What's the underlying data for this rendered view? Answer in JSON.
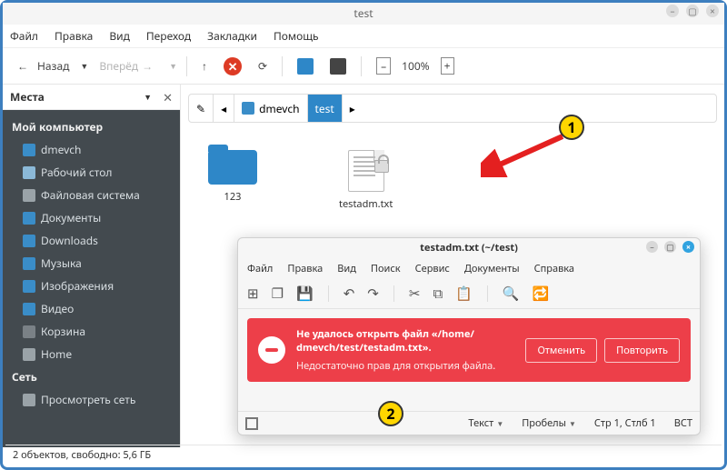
{
  "window": {
    "title": "test"
  },
  "menubar": [
    "Файл",
    "Правка",
    "Вид",
    "Переход",
    "Закладки",
    "Помощь"
  ],
  "toolbar": {
    "back": "Назад",
    "forward": "Вперёд",
    "zoom": "100%"
  },
  "sidebar": {
    "title": "Места",
    "sections": [
      {
        "label": "Мой компьютер",
        "items": [
          {
            "label": "dmevch",
            "icon": "folder"
          },
          {
            "label": "Рабочий стол",
            "icon": "folder-light"
          },
          {
            "label": "Файловая система",
            "icon": "disk"
          },
          {
            "label": "Документы",
            "icon": "folder"
          },
          {
            "label": "Downloads",
            "icon": "folder"
          },
          {
            "label": "Музыка",
            "icon": "folder"
          },
          {
            "label": "Изображения",
            "icon": "folder"
          },
          {
            "label": "Видео",
            "icon": "folder"
          },
          {
            "label": "Корзина",
            "icon": "trash"
          },
          {
            "label": "Home",
            "icon": "disk"
          }
        ]
      },
      {
        "label": "Сеть",
        "items": [
          {
            "label": "Просмотреть сеть",
            "icon": "disk"
          }
        ]
      }
    ]
  },
  "path": {
    "segments": [
      "dmevch",
      "test"
    ],
    "active_index": 1
  },
  "files": [
    {
      "name": "123",
      "type": "folder"
    },
    {
      "name": "testadm.txt",
      "type": "txt-locked"
    }
  ],
  "status": "2 объектов, свободно: 5,6 ГБ",
  "annotations": {
    "marker1": "1",
    "marker2": "2"
  },
  "editor": {
    "title": "testadm.txt (~/test)",
    "menu": [
      "Файл",
      "Правка",
      "Вид",
      "Поиск",
      "Сервис",
      "Документы",
      "Справка"
    ],
    "error": {
      "line1": "Не удалось открыть файл «/home/",
      "line2": "dmevch/test/testadm.txt».",
      "detail": "Недостаточно прав для открытия файла.",
      "cancel": "Отменить",
      "retry": "Повторить"
    },
    "status": {
      "mode": "Текст",
      "spaces": "Пробелы",
      "pos": "Стр 1, Стлб 1",
      "ins": "ВСТ"
    }
  }
}
